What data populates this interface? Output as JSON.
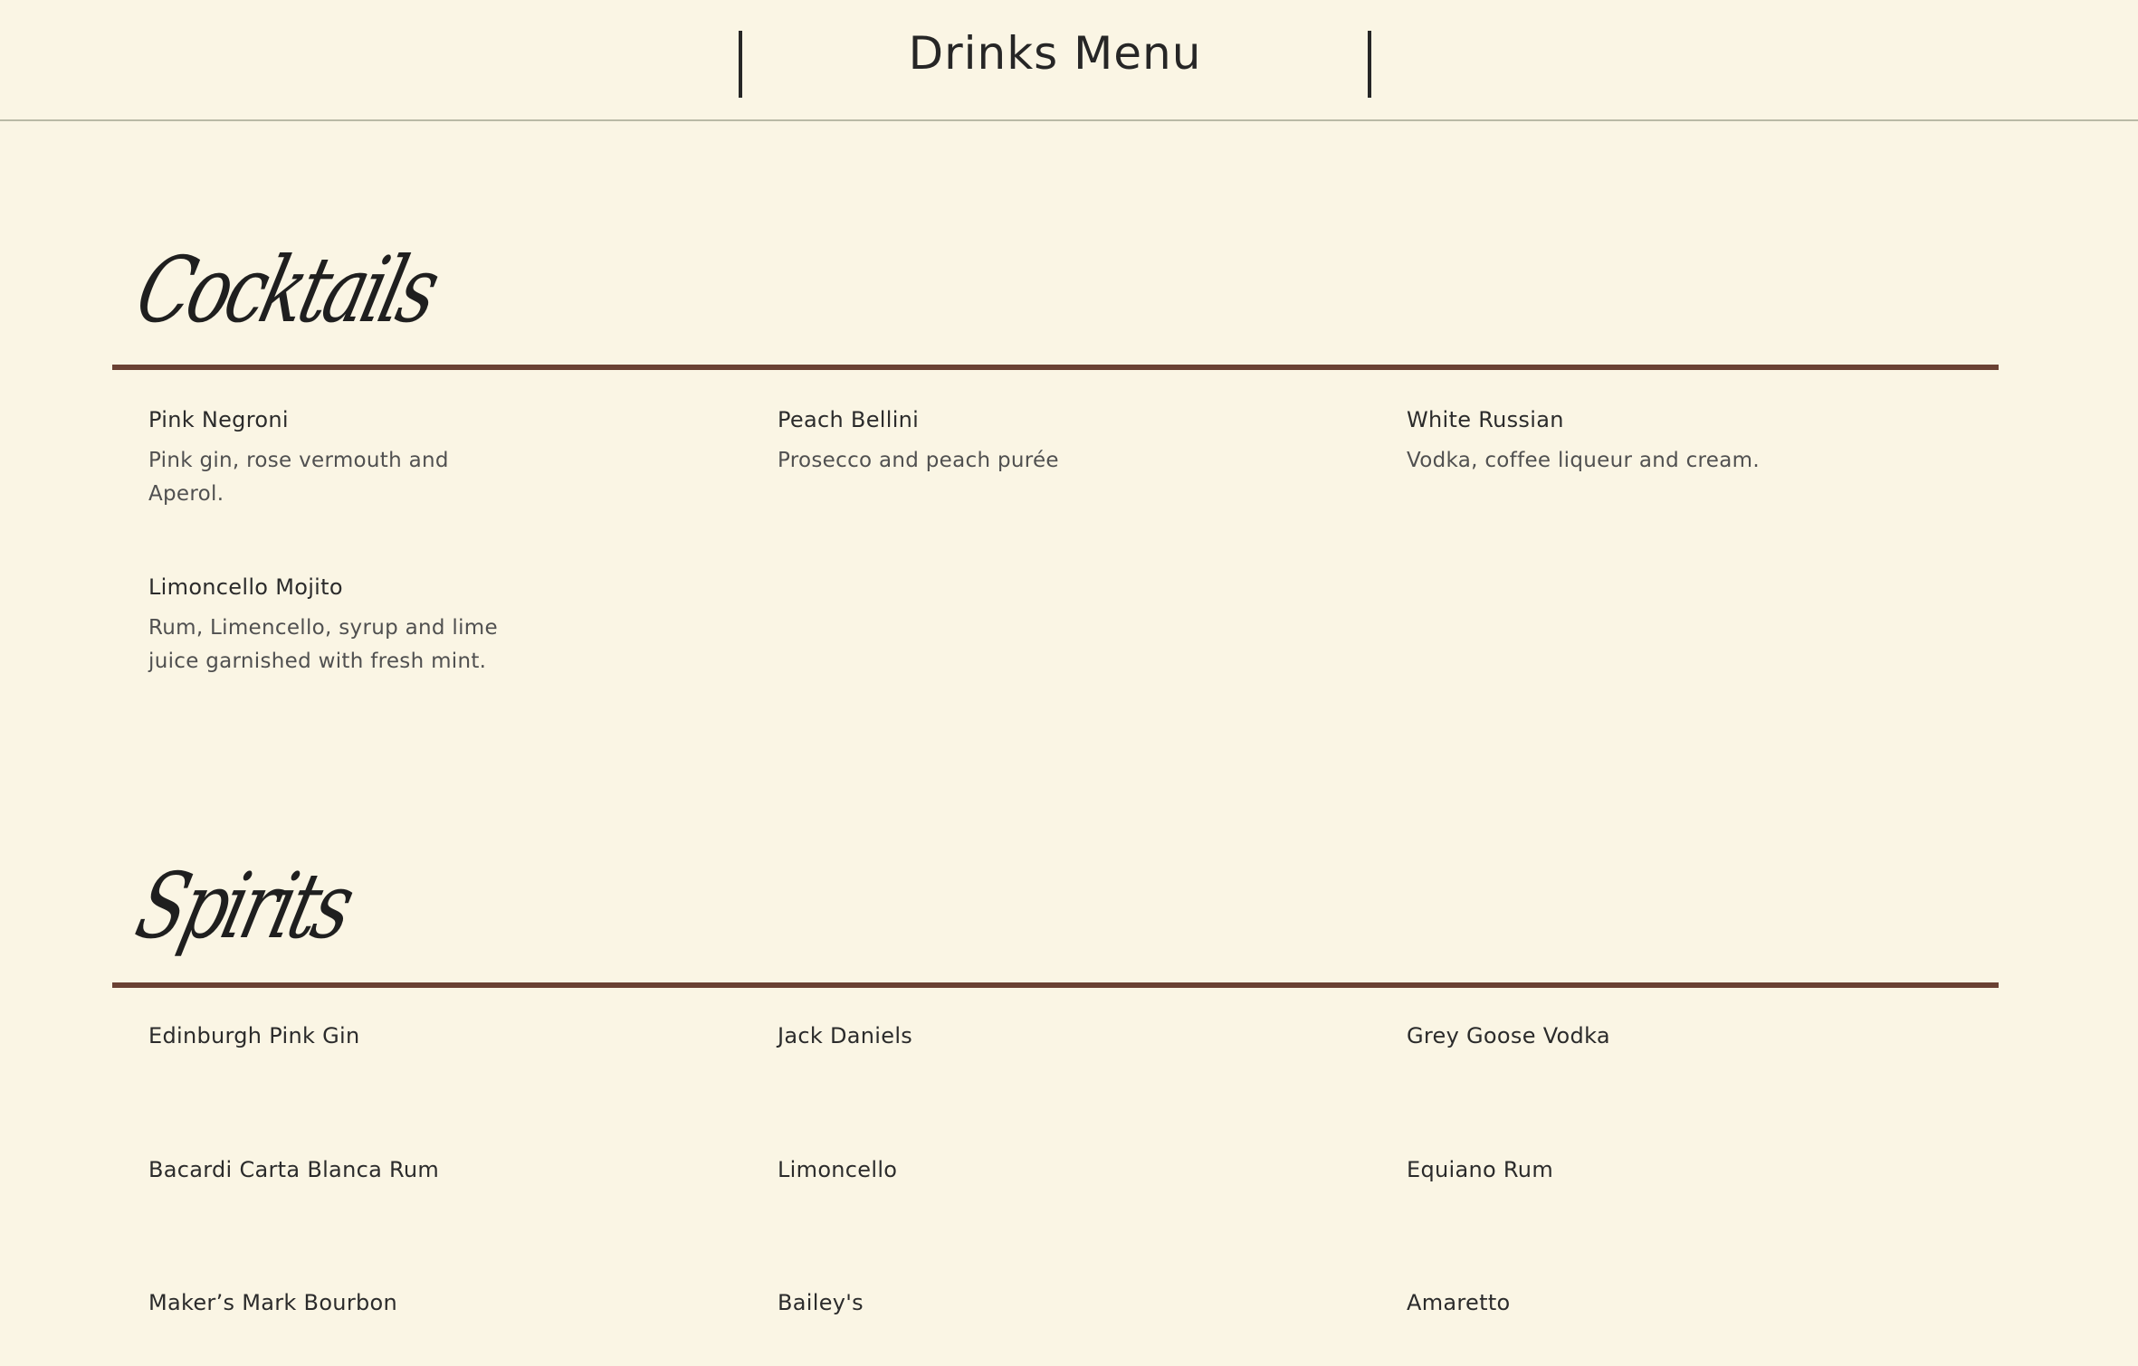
{
  "header": {
    "title": "Drinks Menu"
  },
  "cocktails": {
    "title": "Cocktails",
    "items": [
      {
        "name": "Pink Negroni",
        "description": "Pink gin, rose vermouth and Aperol."
      },
      {
        "name": "Peach Bellini",
        "description": "Prosecco and peach purée"
      },
      {
        "name": "White Russian",
        "description": "Vodka, coffee liqueur and cream."
      },
      {
        "name": "Limoncello Mojito",
        "description": "Rum, Limencello, syrup and lime juice garnished with fresh mint."
      }
    ]
  },
  "spirits": {
    "title": "Spirits",
    "items": [
      {
        "name": "Edinburgh Pink Gin"
      },
      {
        "name": "Jack Daniels"
      },
      {
        "name": "Grey Goose Vodka"
      },
      {
        "name": "Bacardi Carta Blanca Rum"
      },
      {
        "name": "Limoncello"
      },
      {
        "name": "Equiano Rum"
      },
      {
        "name": "Maker’s Mark Bourbon"
      },
      {
        "name": "Bailey's"
      },
      {
        "name": "Amaretto"
      }
    ]
  },
  "colors": {
    "background": "#faf5e4",
    "rule": "#6a4133",
    "text": "#2b2b2b"
  }
}
